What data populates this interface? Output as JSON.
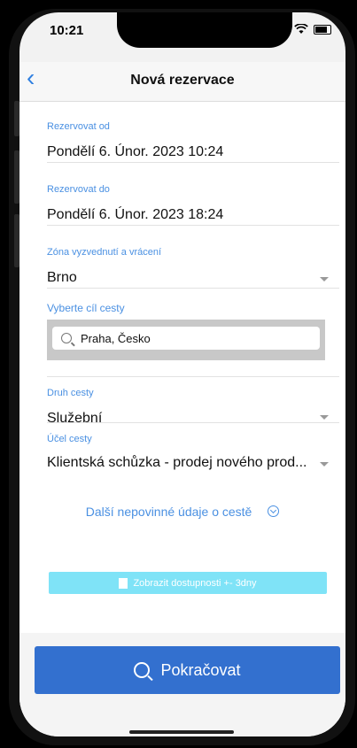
{
  "status": {
    "time": "10:21",
    "dots": "...."
  },
  "navbar": {
    "title": "Nová rezervace",
    "back": "‹"
  },
  "form": {
    "from": {
      "label": "Rezervovat od",
      "value": "Pondělí 6. Únor. 2023 10:24"
    },
    "to": {
      "label": "Rezervovat do",
      "value": "Pondělí 6. Únor. 2023 18:24"
    },
    "zone": {
      "label": "Zóna vyzvednutí a vrácení",
      "value": "Brno"
    },
    "destination": {
      "label": "Vyberte cíl cesty",
      "value": "Praha, Česko"
    },
    "trip_type": {
      "label": "Druh cesty",
      "value": "Služební"
    },
    "purpose": {
      "label": "Účel cesty",
      "value": "Klientská schůzka - prodej nového prod..."
    }
  },
  "more_link": "Další nepovinné údaje o cestě",
  "availability_button": "Zobrazit dostupnosti +- 3dny",
  "continue_button": "Pokračovat",
  "colors": {
    "accent": "#4a90e2",
    "primary_button": "#3370cf",
    "availability_button": "#7fe3f7"
  }
}
